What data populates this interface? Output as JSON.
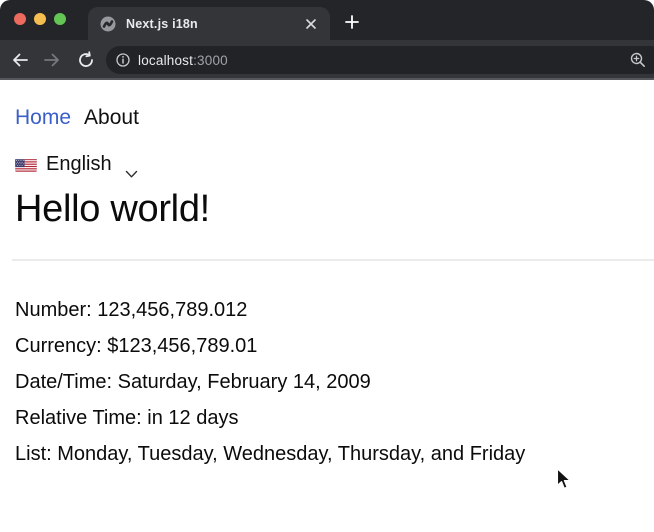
{
  "colors": {
    "link_blue": "#3a5fc8",
    "chrome_frame": "#242528",
    "chrome_toolbar": "#333539",
    "urlbar_bg": "#222327",
    "traffic_red": "#ec6a5e",
    "traffic_yellow": "#f4bf50",
    "traffic_green": "#62c554",
    "page_bg": "#ffffff"
  },
  "browser": {
    "tab_title": "Next.js i18n",
    "favicon": "nextjs-icon",
    "tab_close_icon": "close-x-icon",
    "new_tab_icon": "plus-icon",
    "back_icon": "arrow-left-icon",
    "forward_icon": "arrow-right-icon",
    "reload_icon": "reload-icon",
    "site_info_icon": "info-circle-icon",
    "zoom_icon": "magnifier-plus-icon",
    "url_host": "localhost",
    "url_port": ":3000"
  },
  "page": {
    "nav": [
      {
        "label": "Home"
      },
      {
        "label": "About"
      }
    ],
    "language_selector": {
      "flag_icon": "us-flag-icon",
      "label": "English",
      "chevron_icon": "chevron-down-icon"
    },
    "heading": "Hello world!",
    "lines": [
      "Number: 123,456,789.012",
      "Currency: $123,456,789.01",
      "Date/Time: Saturday, February 14, 2009",
      "Relative Time: in 12 days",
      "List: Monday, Tuesday, Wednesday, Thursday, and Friday"
    ]
  }
}
